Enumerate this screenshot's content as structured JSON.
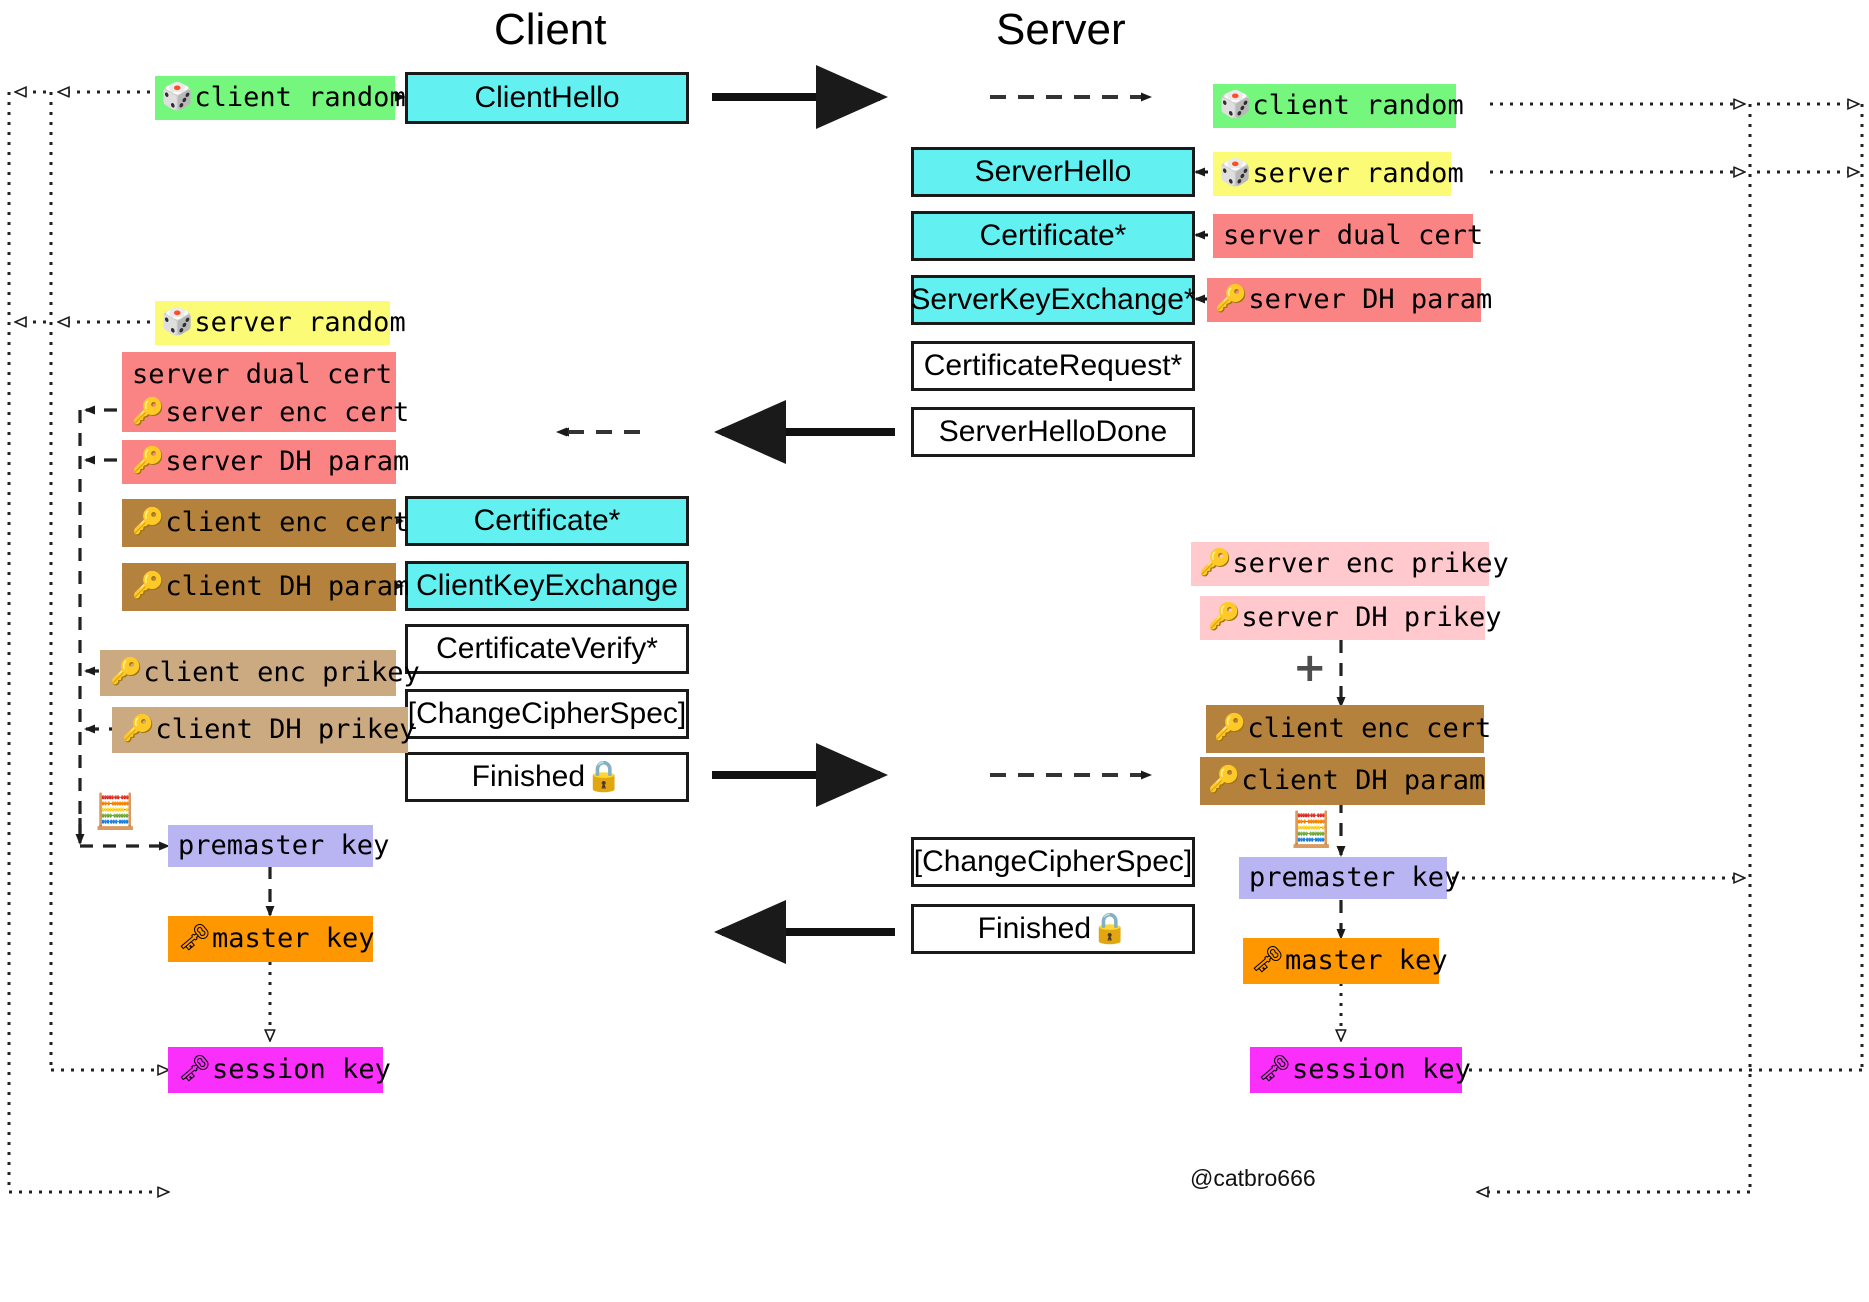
{
  "headers": {
    "client": "Client",
    "server": "Server"
  },
  "watermark": "@catbro666",
  "plus_sign": "+",
  "icons": {
    "dice": "🎲",
    "key": "🔑",
    "old_key": "🗝",
    "abacus": "🧮",
    "lock": "🔒"
  },
  "colors": {
    "cyan": "#62f0f0",
    "green": "#74f77c",
    "yellow": "#fbfb76",
    "salmon": "#fa8484",
    "brown": "#b5823d",
    "tan": "#cbaa82",
    "pink": "#ffc9ce",
    "purple": "#b9b4f2",
    "orange": "#ff9800",
    "magenta": "#fb2ffb",
    "white": "#ffffff",
    "stroke": "#1a1a1a"
  },
  "client": {
    "messages": [
      {
        "label": "ClientHello",
        "style": "cyan"
      },
      {
        "label": "Certificate*",
        "style": "cyan"
      },
      {
        "label": "ClientKeyExchange",
        "style": "cyan"
      },
      {
        "label": "CertificateVerify*",
        "style": "white"
      },
      {
        "label": "[ChangeCipherSpec]",
        "style": "white"
      },
      {
        "label": "Finished🔒",
        "style": "white"
      }
    ],
    "chips": [
      {
        "label": "client random",
        "icon": "dice",
        "style": "green"
      },
      {
        "label": "server random",
        "icon": "dice",
        "style": "yellow"
      },
      {
        "label": "server dual cert",
        "icon": "",
        "style": "salmon"
      },
      {
        "label": "server enc cert",
        "icon": "key",
        "style": "salmon"
      },
      {
        "label": "server DH param",
        "icon": "key",
        "style": "salmon"
      },
      {
        "label": "client enc cert",
        "icon": "key",
        "style": "brown"
      },
      {
        "label": "client DH param",
        "icon": "key",
        "style": "brown"
      },
      {
        "label": "client enc prikey",
        "icon": "key",
        "style": "tan"
      },
      {
        "label": "client DH prikey",
        "icon": "key",
        "style": "tan"
      },
      {
        "label": "premaster key",
        "icon": "",
        "style": "purple"
      },
      {
        "label": "master key",
        "icon": "old_key",
        "style": "orange"
      },
      {
        "label": "session key",
        "icon": "old_key",
        "style": "magenta"
      }
    ]
  },
  "server": {
    "messages": [
      {
        "label": "ServerHello",
        "style": "cyan"
      },
      {
        "label": "Certificate*",
        "style": "cyan"
      },
      {
        "label": "ServerKeyExchange*",
        "style": "cyan"
      },
      {
        "label": "CertificateRequest*",
        "style": "white"
      },
      {
        "label": "ServerHelloDone",
        "style": "white"
      },
      {
        "label": "[ChangeCipherSpec]",
        "style": "white"
      },
      {
        "label": "Finished🔒",
        "style": "white"
      }
    ],
    "chips": [
      {
        "label": "client random",
        "icon": "dice",
        "style": "green"
      },
      {
        "label": "server random",
        "icon": "dice",
        "style": "yellow"
      },
      {
        "label": "server dual cert",
        "icon": "",
        "style": "salmon"
      },
      {
        "label": "server DH param",
        "icon": "key",
        "style": "salmon"
      },
      {
        "label": "server enc prikey",
        "icon": "key",
        "style": "pink"
      },
      {
        "label": "server DH prikey",
        "icon": "key",
        "style": "pink"
      },
      {
        "label": "client enc cert",
        "icon": "key",
        "style": "brown"
      },
      {
        "label": "client DH param",
        "icon": "key",
        "style": "brown"
      },
      {
        "label": "premaster key",
        "icon": "",
        "style": "purple"
      },
      {
        "label": "master key",
        "icon": "old_key",
        "style": "orange"
      },
      {
        "label": "session key",
        "icon": "old_key",
        "style": "magenta"
      }
    ]
  }
}
